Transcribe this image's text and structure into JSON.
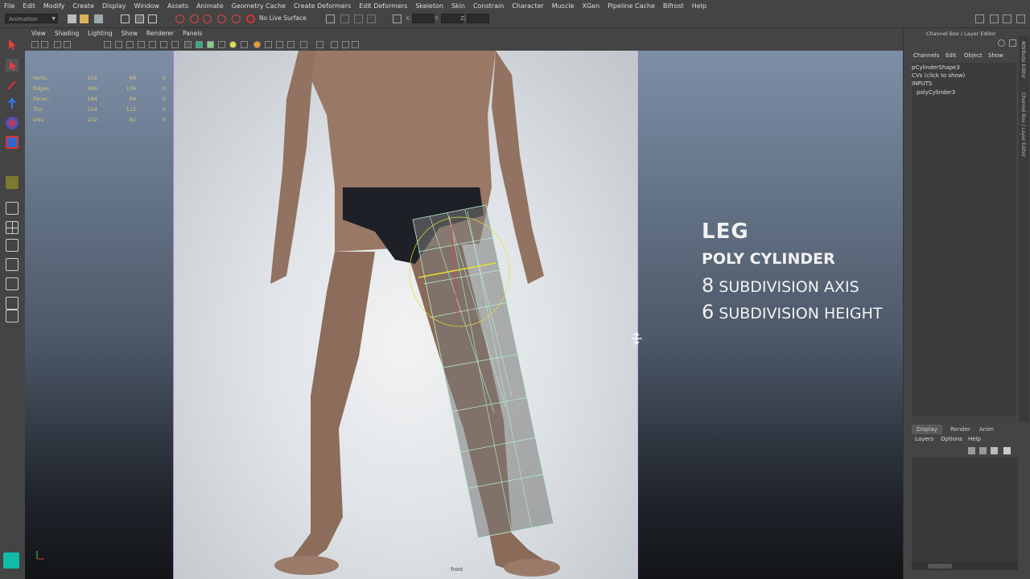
{
  "menu": [
    "File",
    "Edit",
    "Modify",
    "Create",
    "Display",
    "Window",
    "Assets",
    "Animate",
    "Geometry Cache",
    "Create Deformers",
    "Edit Deformers",
    "Skeleton",
    "Skin",
    "Constrain",
    "Character",
    "Muscle",
    "XGen",
    "Pipeline Cache",
    "Bifrost",
    "Help"
  ],
  "status": {
    "mode": "Animation",
    "no_live_surface": "No Live Surface",
    "x_label": "X:",
    "y_label": "Y:",
    "z_label": "Z:"
  },
  "panel_menu": [
    "View",
    "Shading",
    "Lighting",
    "Show",
    "Renderer",
    "Panels"
  ],
  "hud": [
    {
      "label": "Verts:",
      "v1": "152",
      "v2": "68",
      "v3": "0"
    },
    {
      "label": "Edges:",
      "v1": "386",
      "v2": "136",
      "v3": "0"
    },
    {
      "label": "Faces:",
      "v1": "184",
      "v2": "64",
      "v3": "0"
    },
    {
      "label": "Tris:",
      "v1": "224",
      "v2": "112",
      "v3": "0"
    },
    {
      "label": "UVs:",
      "v1": "232",
      "v2": "81",
      "v3": "0"
    }
  ],
  "overlay": {
    "title": "LEG",
    "subtitle": "POLY CYLINDER",
    "line1_num": "8",
    "line1_text": "SUBDIVISION AXIS",
    "line2_num": "6",
    "line2_text": "SUBDIVISION HEIGHT"
  },
  "camera_label": "front",
  "channel_box": {
    "title": "Channel Box / Layer Editor",
    "menu": [
      "Channels",
      "Edit",
      "Object",
      "Show"
    ],
    "shape": "pCylinderShape3",
    "cvs": "CVs (click to show)",
    "inputs": "INPUTS",
    "history": "polyCylinder3",
    "side_tabs": [
      "Attribute Editor",
      "Channel Box / Layer Editor"
    ]
  },
  "layer_editor": {
    "tabs": [
      "Display",
      "Render",
      "Anim"
    ],
    "active_tab": "Display",
    "menu": [
      "Layers",
      "Options",
      "Help"
    ]
  },
  "colors": {
    "hud_text": "#d8c870",
    "image_plane_border": "#c9a6e6",
    "cylinder_wire": "#b8f0d0",
    "selected_edge": "#e8e030"
  }
}
